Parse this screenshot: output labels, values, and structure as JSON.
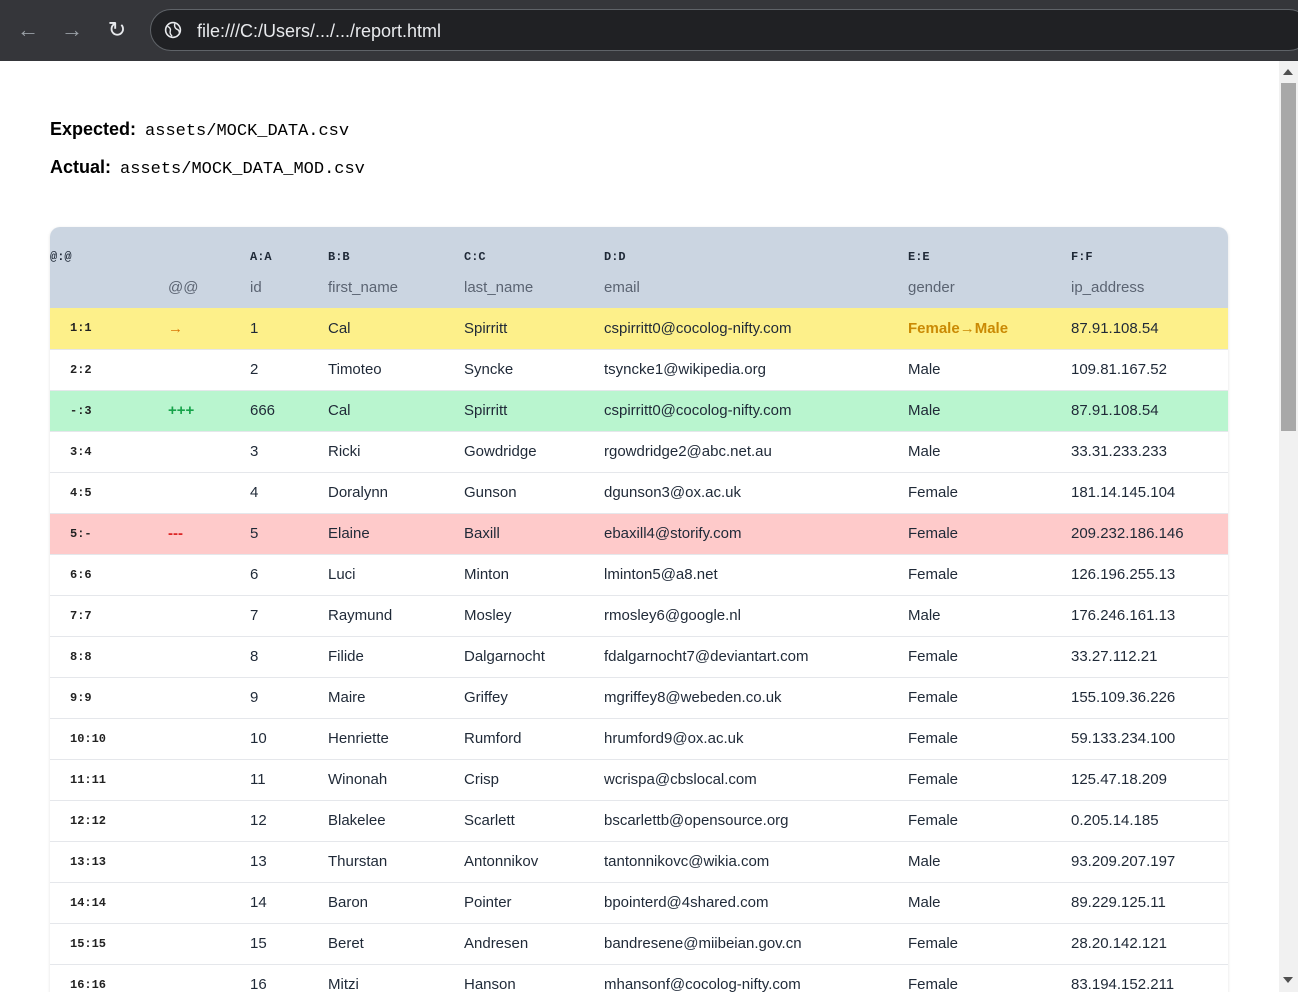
{
  "browser": {
    "url": "file:///C:/Users/.../.../report.html",
    "back_icon": "←",
    "forward_icon": "→",
    "reload_icon": "↻"
  },
  "meta": {
    "expected_label": "Expected:",
    "expected_path": "assets/MOCK_DATA.csv",
    "actual_label": "Actual:",
    "actual_path": "assets/MOCK_DATA_MOD.csv"
  },
  "table": {
    "col_refs": [
      "@:@",
      "",
      "A:A",
      "B:B",
      "C:C",
      "D:D",
      "E:E",
      "F:F"
    ],
    "col_names": [
      "",
      "@@",
      "id",
      "first_name",
      "last_name",
      "email",
      "gender",
      "ip_address"
    ],
    "rows": [
      {
        "key": "1:1",
        "status": "mod",
        "marker": "→",
        "id": "1",
        "first_name": "Cal",
        "last_name": "Spirritt",
        "email": "cspirritt0@cocolog-nifty.com",
        "gender": "Female→Male",
        "ip_address": "87.91.108.54"
      },
      {
        "key": "2:2",
        "status": "",
        "marker": "",
        "id": "2",
        "first_name": "Timoteo",
        "last_name": "Syncke",
        "email": "tsyncke1@wikipedia.org",
        "gender": "Male",
        "ip_address": "109.81.167.52"
      },
      {
        "key": "-:3",
        "status": "add",
        "marker": "+++",
        "id": "666",
        "first_name": "Cal",
        "last_name": "Spirritt",
        "email": "cspirritt0@cocolog-nifty.com",
        "gender": "Male",
        "ip_address": "87.91.108.54"
      },
      {
        "key": "3:4",
        "status": "",
        "marker": "",
        "id": "3",
        "first_name": "Ricki",
        "last_name": "Gowdridge",
        "email": "rgowdridge2@abc.net.au",
        "gender": "Male",
        "ip_address": "33.31.233.233"
      },
      {
        "key": "4:5",
        "status": "",
        "marker": "",
        "id": "4",
        "first_name": "Doralynn",
        "last_name": "Gunson",
        "email": "dgunson3@ox.ac.uk",
        "gender": "Female",
        "ip_address": "181.14.145.104"
      },
      {
        "key": "5:-",
        "status": "del",
        "marker": "---",
        "id": "5",
        "first_name": "Elaine",
        "last_name": "Baxill",
        "email": "ebaxill4@storify.com",
        "gender": "Female",
        "ip_address": "209.232.186.146"
      },
      {
        "key": "6:6",
        "status": "",
        "marker": "",
        "id": "6",
        "first_name": "Luci",
        "last_name": "Minton",
        "email": "lminton5@a8.net",
        "gender": "Female",
        "ip_address": "126.196.255.13"
      },
      {
        "key": "7:7",
        "status": "",
        "marker": "",
        "id": "7",
        "first_name": "Raymund",
        "last_name": "Mosley",
        "email": "rmosley6@google.nl",
        "gender": "Male",
        "ip_address": "176.246.161.13"
      },
      {
        "key": "8:8",
        "status": "",
        "marker": "",
        "id": "8",
        "first_name": "Filide",
        "last_name": "Dalgarnocht",
        "email": "fdalgarnocht7@deviantart.com",
        "gender": "Female",
        "ip_address": "33.27.112.21"
      },
      {
        "key": "9:9",
        "status": "",
        "marker": "",
        "id": "9",
        "first_name": "Maire",
        "last_name": "Griffey",
        "email": "mgriffey8@webeden.co.uk",
        "gender": "Female",
        "ip_address": "155.109.36.226"
      },
      {
        "key": "10:10",
        "status": "",
        "marker": "",
        "id": "10",
        "first_name": "Henriette",
        "last_name": "Rumford",
        "email": "hrumford9@ox.ac.uk",
        "gender": "Female",
        "ip_address": "59.133.234.100"
      },
      {
        "key": "11:11",
        "status": "",
        "marker": "",
        "id": "11",
        "first_name": "Winonah",
        "last_name": "Crisp",
        "email": "wcrispa@cbslocal.com",
        "gender": "Female",
        "ip_address": "125.47.18.209"
      },
      {
        "key": "12:12",
        "status": "",
        "marker": "",
        "id": "12",
        "first_name": "Blakelee",
        "last_name": "Scarlett",
        "email": "bscarlettb@opensource.org",
        "gender": "Female",
        "ip_address": "0.205.14.185"
      },
      {
        "key": "13:13",
        "status": "",
        "marker": "",
        "id": "13",
        "first_name": "Thurstan",
        "last_name": "Antonnikov",
        "email": "tantonnikovc@wikia.com",
        "gender": "Male",
        "ip_address": "93.209.207.197"
      },
      {
        "key": "14:14",
        "status": "",
        "marker": "",
        "id": "14",
        "first_name": "Baron",
        "last_name": "Pointer",
        "email": "bpointerd@4shared.com",
        "gender": "Male",
        "ip_address": "89.229.125.11"
      },
      {
        "key": "15:15",
        "status": "",
        "marker": "",
        "id": "15",
        "first_name": "Beret",
        "last_name": "Andresen",
        "email": "bandresene@miibeian.gov.cn",
        "gender": "Female",
        "ip_address": "28.20.142.121"
      },
      {
        "key": "16:16",
        "status": "",
        "marker": "",
        "id": "16",
        "first_name": "Mitzi",
        "last_name": "Hanson",
        "email": "mhansonf@cocolog-nifty.com",
        "gender": "Female",
        "ip_address": "83.194.152.211"
      }
    ]
  }
}
